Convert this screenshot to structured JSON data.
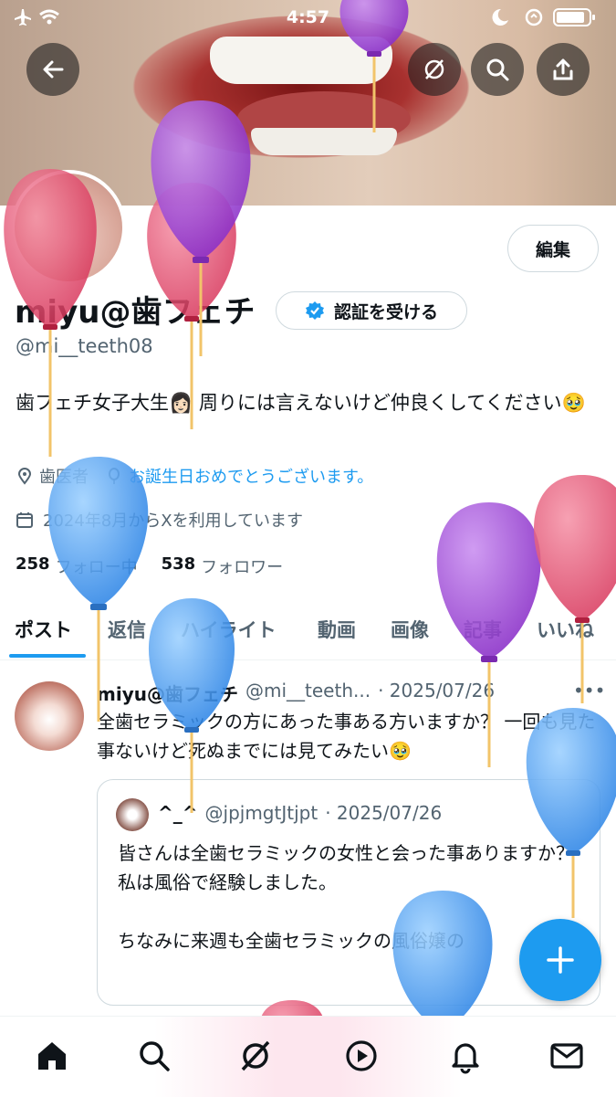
{
  "status_bar": {
    "time": "4:57"
  },
  "profile": {
    "display_name": "miyu@歯フェチ",
    "handle": "@mi__teeth08",
    "edit_label": "編集",
    "verify_label": "認証を受ける",
    "bio": "歯フェチ女子大生👩🏻 周りには言えないけど仲良くしてください🥹",
    "location": "歯医者",
    "birthday": "お誕生日おめでとうございます。",
    "joined": "2024年8月からXを利用しています",
    "following_count": "258",
    "following_label": "フォロー中",
    "followers_count": "538",
    "followers_label": "フォロワー"
  },
  "tabs": [
    "ポスト",
    "返信",
    "ハイライト",
    "動画",
    "画像",
    "記事",
    "いいね"
  ],
  "post": {
    "name": "miyu@歯フェチ",
    "handle": "@mi__teeth...",
    "date": "· 2025/07/26",
    "text": "全歯セラミックの方にあった事ある方いますか？ 一回も見た事ないけど死ぬまでには見てみたい🥹",
    "quote": {
      "name": "^_^",
      "handle": "@jpjmgtJtjpt",
      "date": "· 2025/07/26",
      "text": "皆さんは全歯セラミックの女性と会った事ありますか？\n私は風俗で経験しました。\n\nちなみに来週も全歯セラミックの風俗嬢の"
    }
  },
  "colors": {
    "accent": "#1d9bf0",
    "balloon_blue": "#4a9ef0",
    "balloon_purple": "#9b3fd6",
    "balloon_red": "#e34a6a"
  }
}
